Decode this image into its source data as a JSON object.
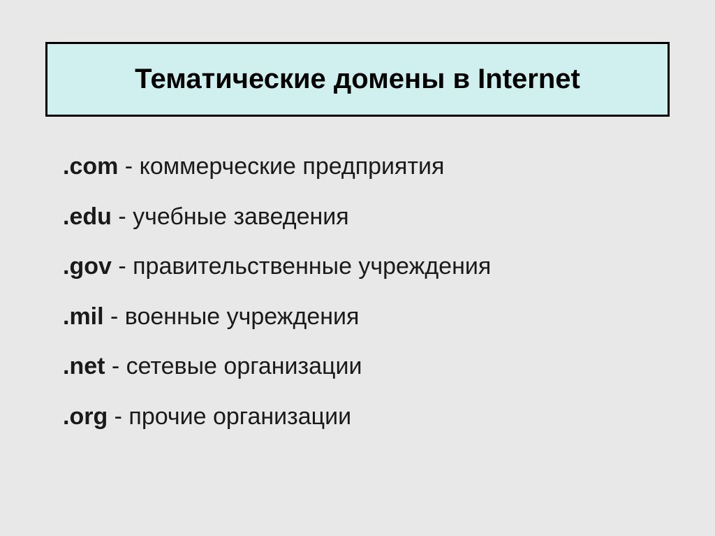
{
  "title": "Тематические домены в Internet",
  "domains": [
    {
      "name": ".com",
      "desc": " - коммерческие предприятия"
    },
    {
      "name": ".edu",
      "desc": " - учебные заведения"
    },
    {
      "name": ".gov",
      "desc": " - правительственные учреждения"
    },
    {
      "name": ".mil",
      "desc": " - военные учреждения"
    },
    {
      "name": ".net",
      "desc": " - сетевые организации"
    },
    {
      "name": ".org",
      "desc": " - прочие организации"
    }
  ]
}
